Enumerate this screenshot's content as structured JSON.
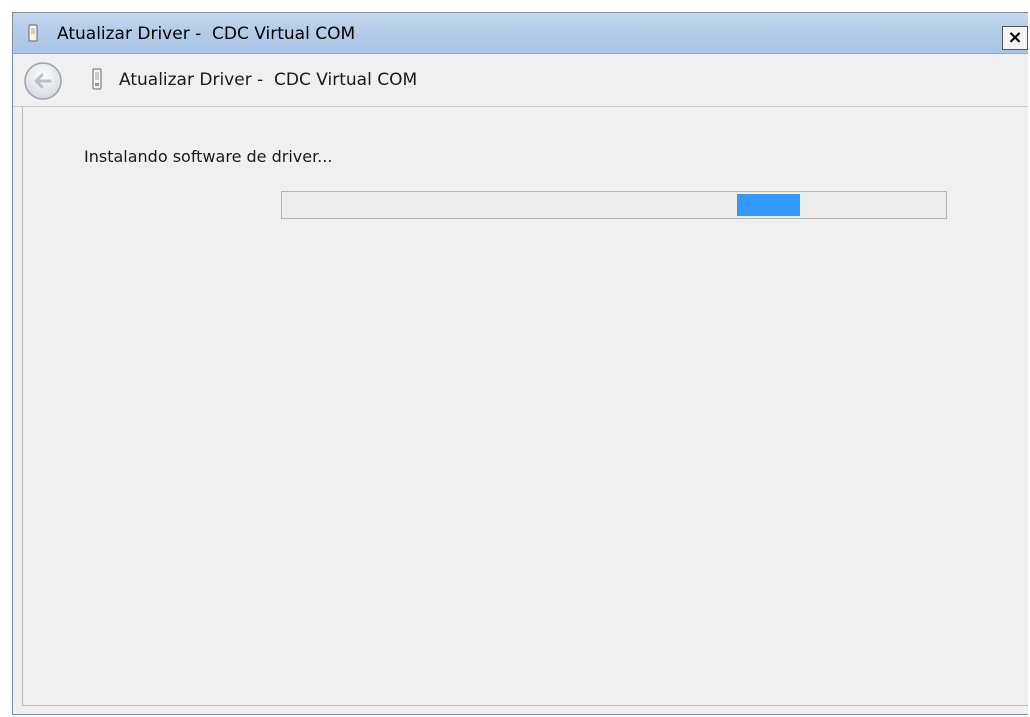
{
  "window": {
    "title": "Atualizar Driver -  CDC Virtual COM",
    "close_label": "×"
  },
  "navbar": {
    "title": "Atualizar Driver -  CDC Virtual COM"
  },
  "content": {
    "status": "Instalando software de driver..."
  },
  "progress": {
    "type": "marquee",
    "segment_start": 0.685,
    "segment_end": 0.78,
    "color": "#3399ff"
  },
  "icons": {
    "title": "device-icon",
    "back": "back-arrow-icon",
    "nav": "device-icon",
    "close": "close-icon"
  }
}
